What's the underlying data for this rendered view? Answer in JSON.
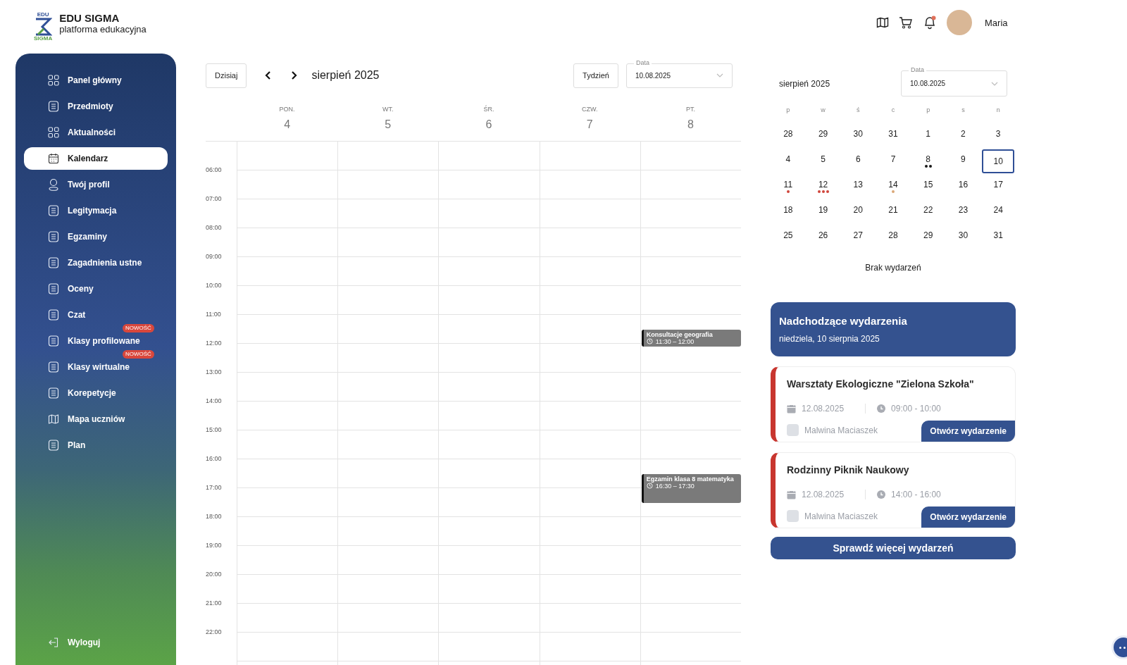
{
  "brand": {
    "logo_top": "EDU",
    "logo_bottom": "SIGMA",
    "title": "EDU SIGMA",
    "subtitle": "platforma edukacyjna"
  },
  "header": {
    "user_name": "Maria",
    "notification_unread": true
  },
  "sidebar": {
    "items": [
      {
        "label": "Panel główny",
        "selected": false
      },
      {
        "label": "Przedmioty",
        "selected": false
      },
      {
        "label": "Aktualności",
        "selected": false
      },
      {
        "label": "Kalendarz",
        "selected": true
      },
      {
        "label": "Twój profil",
        "selected": false
      },
      {
        "label": "Legitymacja",
        "selected": false
      },
      {
        "label": "Egzaminy",
        "selected": false
      },
      {
        "label": "Zagadnienia ustne",
        "selected": false
      },
      {
        "label": "Oceny",
        "selected": false
      },
      {
        "label": "Czat",
        "selected": false
      },
      {
        "label": "Klasy profilowane",
        "selected": false,
        "badge": "NOWOŚĆ"
      },
      {
        "label": "Klasy wirtualne",
        "selected": false,
        "badge": "NOWOŚĆ"
      },
      {
        "label": "Korepetycje",
        "selected": false
      },
      {
        "label": "Mapa uczniów",
        "selected": false
      },
      {
        "label": "Plan",
        "selected": false
      }
    ],
    "logout": "Wyloguj"
  },
  "week_view": {
    "today_button": "Dzisiaj",
    "title": "sierpień 2025",
    "view_button": "Tydzień",
    "date_field": {
      "label": "Data",
      "value": "10.08.2025"
    },
    "days": [
      {
        "name": "PON.",
        "number": "4"
      },
      {
        "name": "WT.",
        "number": "5"
      },
      {
        "name": "ŚR.",
        "number": "6"
      },
      {
        "name": "CZW.",
        "number": "7"
      },
      {
        "name": "PT.",
        "number": "8",
        "events": [
          {
            "title": "Konsultacje geografia",
            "time": "11:30 – 12:00"
          },
          {
            "title": "Egzamin klasa 8 matematyka",
            "time": "16:30 – 17:30"
          }
        ]
      }
    ],
    "hours": [
      "06:00",
      "07:00",
      "08:00",
      "09:00",
      "10:00",
      "11:00",
      "12:00",
      "13:00",
      "14:00",
      "15:00",
      "16:00",
      "17:00",
      "18:00",
      "19:00",
      "20:00",
      "21:00",
      "22:00"
    ]
  },
  "mini_calendar": {
    "title": "sierpień 2025",
    "date_field": {
      "label": "Data",
      "value": "10.08.2025"
    },
    "weekdays": [
      "p",
      "w",
      "ś",
      "c",
      "p",
      "s",
      "n"
    ],
    "weeks": [
      [
        {
          "day": "28",
          "selected": false
        },
        {
          "day": "29",
          "selected": false
        },
        {
          "day": "30",
          "selected": false
        },
        {
          "day": "31",
          "selected": false
        },
        {
          "day": "1",
          "selected": false
        },
        {
          "day": "2",
          "selected": false
        },
        {
          "day": "3",
          "selected": false
        }
      ],
      [
        {
          "day": "4",
          "selected": false
        },
        {
          "day": "5",
          "selected": false
        },
        {
          "day": "6",
          "selected": false
        },
        {
          "day": "7",
          "selected": false
        },
        {
          "day": "8",
          "selected": false,
          "dots": [
            {
              "color": "#1a1a1a"
            },
            {
              "color": "#1a1a1a"
            }
          ]
        },
        {
          "day": "9",
          "selected": false
        },
        {
          "day": "10",
          "selected": true
        }
      ],
      [
        {
          "day": "11",
          "selected": false,
          "dots": [
            {
              "color": "#d0463b"
            }
          ]
        },
        {
          "day": "12",
          "selected": false,
          "dots": [
            {
              "color": "#d0463b"
            },
            {
              "color": "#d0463b"
            },
            {
              "color": "#d0463b"
            }
          ]
        },
        {
          "day": "13",
          "selected": false
        },
        {
          "day": "14",
          "selected": false,
          "dots": [
            {
              "color": "#dba878"
            }
          ]
        },
        {
          "day": "15",
          "selected": false
        },
        {
          "day": "16",
          "selected": false
        },
        {
          "day": "17",
          "selected": false
        }
      ],
      [
        {
          "day": "18",
          "selected": false
        },
        {
          "day": "19",
          "selected": false
        },
        {
          "day": "20",
          "selected": false
        },
        {
          "day": "21",
          "selected": false
        },
        {
          "day": "22",
          "selected": false
        },
        {
          "day": "23",
          "selected": false
        },
        {
          "day": "24",
          "selected": false
        }
      ],
      [
        {
          "day": "25",
          "selected": false
        },
        {
          "day": "26",
          "selected": false
        },
        {
          "day": "27",
          "selected": false
        },
        {
          "day": "28",
          "selected": false
        },
        {
          "day": "29",
          "selected": false
        },
        {
          "day": "30",
          "selected": false
        },
        {
          "day": "31",
          "selected": false
        }
      ]
    ],
    "empty_text": "Brak wydarzeń"
  },
  "upcoming": {
    "title": "Nadchodzące wydarzenia",
    "date": "niedziela, 10 sierpnia 2025",
    "events": [
      {
        "title": "Warsztaty Ekologiczne \"Zielona Szkoła\"",
        "date": "12.08.2025",
        "time": "09:00 - 10:00",
        "person": "Malwina Maciaszek",
        "button": "Otwórz wydarzenie",
        "color": "#c8362f"
      },
      {
        "title": "Rodzinny Piknik Naukowy",
        "date": "12.08.2025",
        "time": "14:00 - 16:00",
        "person": "Malwina Maciaszek",
        "button": "Otwórz wydarzenie",
        "color": "#c8362f"
      }
    ],
    "more_button": "Sprawdź więcej wydarzeń"
  }
}
